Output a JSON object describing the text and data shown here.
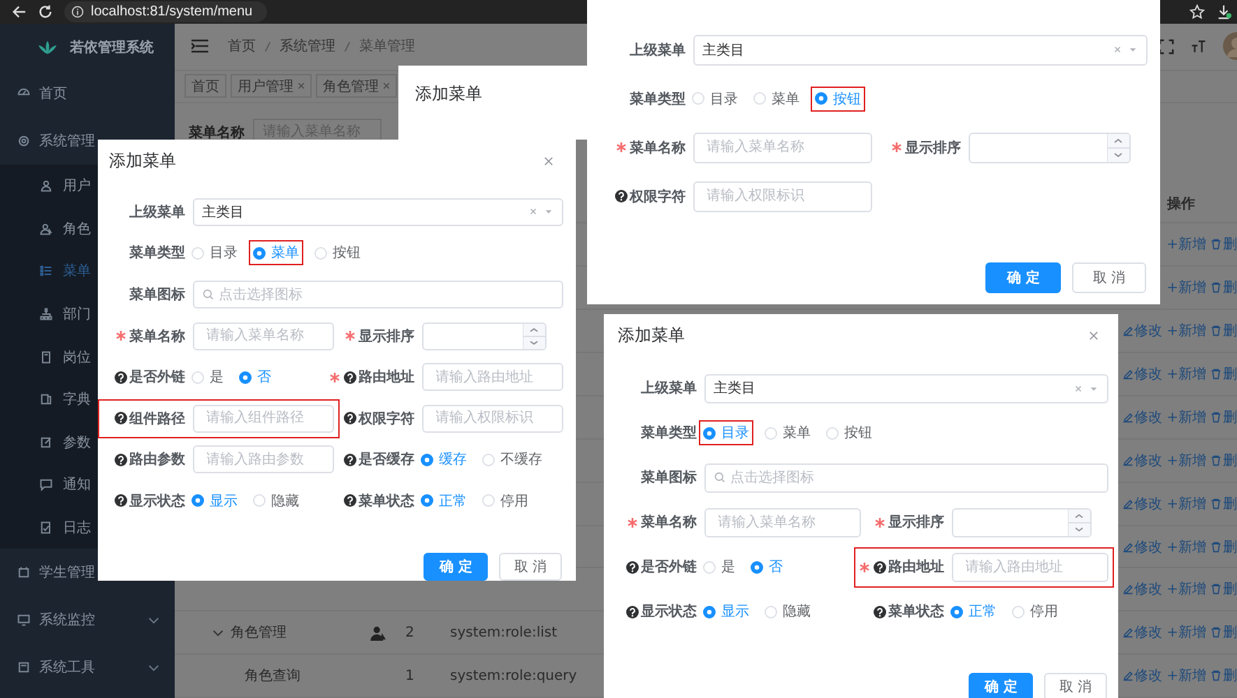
{
  "browser": {
    "url": "localhost:81/system/menu"
  },
  "sidebar": {
    "title": "若依管理系统",
    "items": [
      {
        "label": "首页"
      },
      {
        "label": "系统管理",
        "children": [
          {
            "label": "用户",
            "selected": false
          },
          {
            "label": "角色",
            "selected": false
          },
          {
            "label": "菜单",
            "selected": true
          },
          {
            "label": "部门",
            "selected": false
          },
          {
            "label": "岗位",
            "selected": false
          },
          {
            "label": "字典",
            "selected": false
          },
          {
            "label": "参数",
            "selected": false
          },
          {
            "label": "通知",
            "selected": false
          },
          {
            "label": "日志",
            "selected": false
          }
        ]
      },
      {
        "label": "学生管理"
      },
      {
        "label": "系统监控",
        "expanded": false
      },
      {
        "label": "系统工具",
        "expanded": false
      }
    ]
  },
  "header": {
    "breadcrumb": [
      "首页",
      "系统管理",
      "菜单管理"
    ]
  },
  "tags": [
    {
      "label": "首页",
      "closable": false
    },
    {
      "label": "用户管理",
      "closable": true
    },
    {
      "label": "角色管理",
      "closable": true
    }
  ],
  "search": {
    "label": "菜单名称",
    "placeholder": "请输入菜单名称"
  },
  "table": {
    "action_header": "操作",
    "rows": [
      {
        "actions": [
          {
            "kind": "add",
            "label": "+新增"
          },
          {
            "kind": "delete",
            "label": "删"
          }
        ]
      },
      {
        "actions": [
          {
            "kind": "add",
            "label": "+新增"
          },
          {
            "kind": "delete",
            "label": "删"
          }
        ]
      },
      {
        "actions": [
          {
            "kind": "edit",
            "label": "修改"
          },
          {
            "kind": "add",
            "label": "+新增"
          },
          {
            "kind": "delete",
            "label": "删"
          }
        ]
      },
      {
        "actions": [
          {
            "kind": "edit",
            "label": "修改"
          },
          {
            "kind": "add",
            "label": "+新增"
          },
          {
            "kind": "delete",
            "label": "删"
          }
        ]
      },
      {
        "actions": [
          {
            "kind": "edit",
            "label": "修改"
          },
          {
            "kind": "add",
            "label": "+新增"
          },
          {
            "kind": "delete",
            "label": "删"
          }
        ]
      },
      {
        "actions": [
          {
            "kind": "edit",
            "label": "修改"
          },
          {
            "kind": "add",
            "label": "+新增"
          },
          {
            "kind": "delete",
            "label": "删"
          }
        ]
      },
      {
        "actions": [
          {
            "kind": "edit",
            "label": "修改"
          },
          {
            "kind": "add",
            "label": "+新增"
          },
          {
            "kind": "delete",
            "label": "删"
          }
        ]
      },
      {
        "actions": [
          {
            "kind": "edit",
            "label": "修改"
          },
          {
            "kind": "add",
            "label": "+新增"
          },
          {
            "kind": "delete",
            "label": "删"
          }
        ]
      },
      {
        "actions": [
          {
            "kind": "edit",
            "label": "修改"
          },
          {
            "kind": "add",
            "label": "+新增"
          },
          {
            "kind": "delete",
            "label": "删"
          }
        ]
      },
      {
        "kind": "menu",
        "name": "角色管理",
        "sort": "2",
        "perm": "system:role:list",
        "actions": [
          {
            "kind": "edit",
            "label": "修改"
          },
          {
            "kind": "add",
            "label": "+新增"
          },
          {
            "kind": "delete",
            "label": "删"
          }
        ]
      },
      {
        "kind": "button",
        "name": "角色查询",
        "sort": "1",
        "perm": "system:role:query",
        "actions": [
          {
            "kind": "edit",
            "label": "修改"
          },
          {
            "kind": "add",
            "label": "+新增"
          },
          {
            "kind": "delete",
            "label": "删"
          }
        ]
      }
    ]
  },
  "dialogs": [
    {
      "title": "添加菜单",
      "closable": false
    },
    {
      "title": "添加菜单",
      "closable": true,
      "rows": [
        [
          {
            "kind": "select",
            "label": "上级菜单",
            "required": false,
            "help": false,
            "highlighted": false,
            "value": "主类目"
          }
        ],
        [
          {
            "kind": "radio",
            "label": "菜单类型",
            "required": false,
            "help": false,
            "highlighted": false,
            "options": [
              {
                "label": "目录",
                "selected": false,
                "highlighted": false
              },
              {
                "label": "菜单",
                "selected": true,
                "highlighted": true
              },
              {
                "label": "按钮",
                "selected": false,
                "highlighted": false
              }
            ]
          }
        ],
        [
          {
            "kind": "icon",
            "label": "菜单图标",
            "required": false,
            "help": false,
            "highlighted": false,
            "placeholder": "点击选择图标"
          }
        ],
        [
          {
            "kind": "input",
            "label": "菜单名称",
            "required": true,
            "help": false,
            "highlighted": false,
            "placeholder": "请输入菜单名称"
          },
          {
            "kind": "number",
            "label": "显示排序",
            "required": true,
            "help": false,
            "highlighted": false
          }
        ],
        [
          {
            "kind": "radio",
            "label": "是否外链",
            "required": false,
            "help": true,
            "highlighted": false,
            "options": [
              {
                "label": "是",
                "selected": false,
                "highlighted": false
              },
              {
                "label": "否",
                "selected": true,
                "highlighted": false
              }
            ]
          },
          {
            "kind": "input",
            "label": "路由地址",
            "required": true,
            "help": true,
            "highlighted": false,
            "placeholder": "请输入路由地址"
          }
        ],
        [
          {
            "kind": "input",
            "label": "组件路径",
            "required": false,
            "help": true,
            "highlighted": true,
            "placeholder": "请输入组件路径"
          },
          {
            "kind": "input",
            "label": "权限字符",
            "required": false,
            "help": true,
            "highlighted": false,
            "placeholder": "请输入权限标识"
          }
        ],
        [
          {
            "kind": "input",
            "label": "路由参数",
            "required": false,
            "help": true,
            "highlighted": false,
            "placeholder": "请输入路由参数"
          },
          {
            "kind": "radio",
            "label": "是否缓存",
            "required": false,
            "help": true,
            "highlighted": false,
            "options": [
              {
                "label": "缓存",
                "selected": true,
                "highlighted": false
              },
              {
                "label": "不缓存",
                "selected": false,
                "highlighted": false
              }
            ]
          }
        ],
        [
          {
            "kind": "radio",
            "label": "显示状态",
            "required": false,
            "help": true,
            "highlighted": false,
            "options": [
              {
                "label": "显示",
                "selected": true,
                "highlighted": false
              },
              {
                "label": "隐藏",
                "selected": false,
                "highlighted": false
              }
            ]
          },
          {
            "kind": "radio",
            "label": "菜单状态",
            "required": false,
            "help": true,
            "highlighted": false,
            "options": [
              {
                "label": "正常",
                "selected": true,
                "highlighted": false
              },
              {
                "label": "停用",
                "selected": false,
                "highlighted": false
              }
            ]
          }
        ]
      ],
      "buttons": [
        {
          "kind": "primary",
          "label": "确 定"
        },
        {
          "kind": "default",
          "label": "取 消"
        }
      ]
    },
    {
      "rows": [
        [
          {
            "kind": "select",
            "label": "上级菜单",
            "required": false,
            "help": false,
            "highlighted": false,
            "value": "主类目"
          }
        ],
        [
          {
            "kind": "radio",
            "label": "菜单类型",
            "required": false,
            "help": false,
            "highlighted": false,
            "options": [
              {
                "label": "目录",
                "selected": false,
                "highlighted": false
              },
              {
                "label": "菜单",
                "selected": false,
                "highlighted": false
              },
              {
                "label": "按钮",
                "selected": true,
                "highlighted": true
              }
            ]
          }
        ],
        [
          {
            "kind": "input",
            "label": "菜单名称",
            "required": true,
            "help": false,
            "highlighted": false,
            "placeholder": "请输入菜单名称"
          },
          {
            "kind": "number",
            "label": "显示排序",
            "required": true,
            "help": false,
            "highlighted": false
          }
        ],
        [
          {
            "kind": "input",
            "label": "权限字符",
            "required": false,
            "help": true,
            "highlighted": false,
            "placeholder": "请输入权限标识"
          }
        ]
      ],
      "buttons": [
        {
          "kind": "primary",
          "label": "确 定"
        },
        {
          "kind": "default",
          "label": "取 消"
        }
      ]
    },
    {
      "title": "添加菜单",
      "closable": true,
      "rows": [
        [
          {
            "kind": "select",
            "label": "上级菜单",
            "required": false,
            "help": false,
            "highlighted": false,
            "value": "主类目"
          }
        ],
        [
          {
            "kind": "radio",
            "label": "菜单类型",
            "required": false,
            "help": false,
            "highlighted": false,
            "options": [
              {
                "label": "目录",
                "selected": true,
                "highlighted": true
              },
              {
                "label": "菜单",
                "selected": false,
                "highlighted": false
              },
              {
                "label": "按钮",
                "selected": false,
                "highlighted": false
              }
            ]
          }
        ],
        [
          {
            "kind": "icon",
            "label": "菜单图标",
            "required": false,
            "help": false,
            "highlighted": false,
            "placeholder": "点击选择图标"
          }
        ],
        [
          {
            "kind": "input",
            "label": "菜单名称",
            "required": true,
            "help": false,
            "highlighted": false,
            "placeholder": "请输入菜单名称"
          },
          {
            "kind": "number",
            "label": "显示排序",
            "required": true,
            "help": false,
            "highlighted": false
          }
        ],
        [
          {
            "kind": "radio",
            "label": "是否外链",
            "required": false,
            "help": true,
            "highlighted": false,
            "options": [
              {
                "label": "是",
                "selected": false,
                "highlighted": false
              },
              {
                "label": "否",
                "selected": true,
                "highlighted": false
              }
            ]
          },
          {
            "kind": "input",
            "label": "路由地址",
            "required": true,
            "help": true,
            "highlighted": true,
            "placeholder": "请输入路由地址"
          }
        ],
        [
          {
            "kind": "radio",
            "label": "显示状态",
            "required": false,
            "help": true,
            "highlighted": false,
            "options": [
              {
                "label": "显示",
                "selected": true,
                "highlighted": false
              },
              {
                "label": "隐藏",
                "selected": false,
                "highlighted": false
              }
            ]
          },
          {
            "kind": "radio",
            "label": "菜单状态",
            "required": false,
            "help": true,
            "highlighted": false,
            "options": [
              {
                "label": "正常",
                "selected": true,
                "highlighted": false
              },
              {
                "label": "停用",
                "selected": false,
                "highlighted": false
              }
            ]
          }
        ]
      ],
      "buttons": [
        {
          "kind": "primary",
          "label": "确 定"
        },
        {
          "kind": "default",
          "label": "取 消"
        }
      ]
    }
  ]
}
